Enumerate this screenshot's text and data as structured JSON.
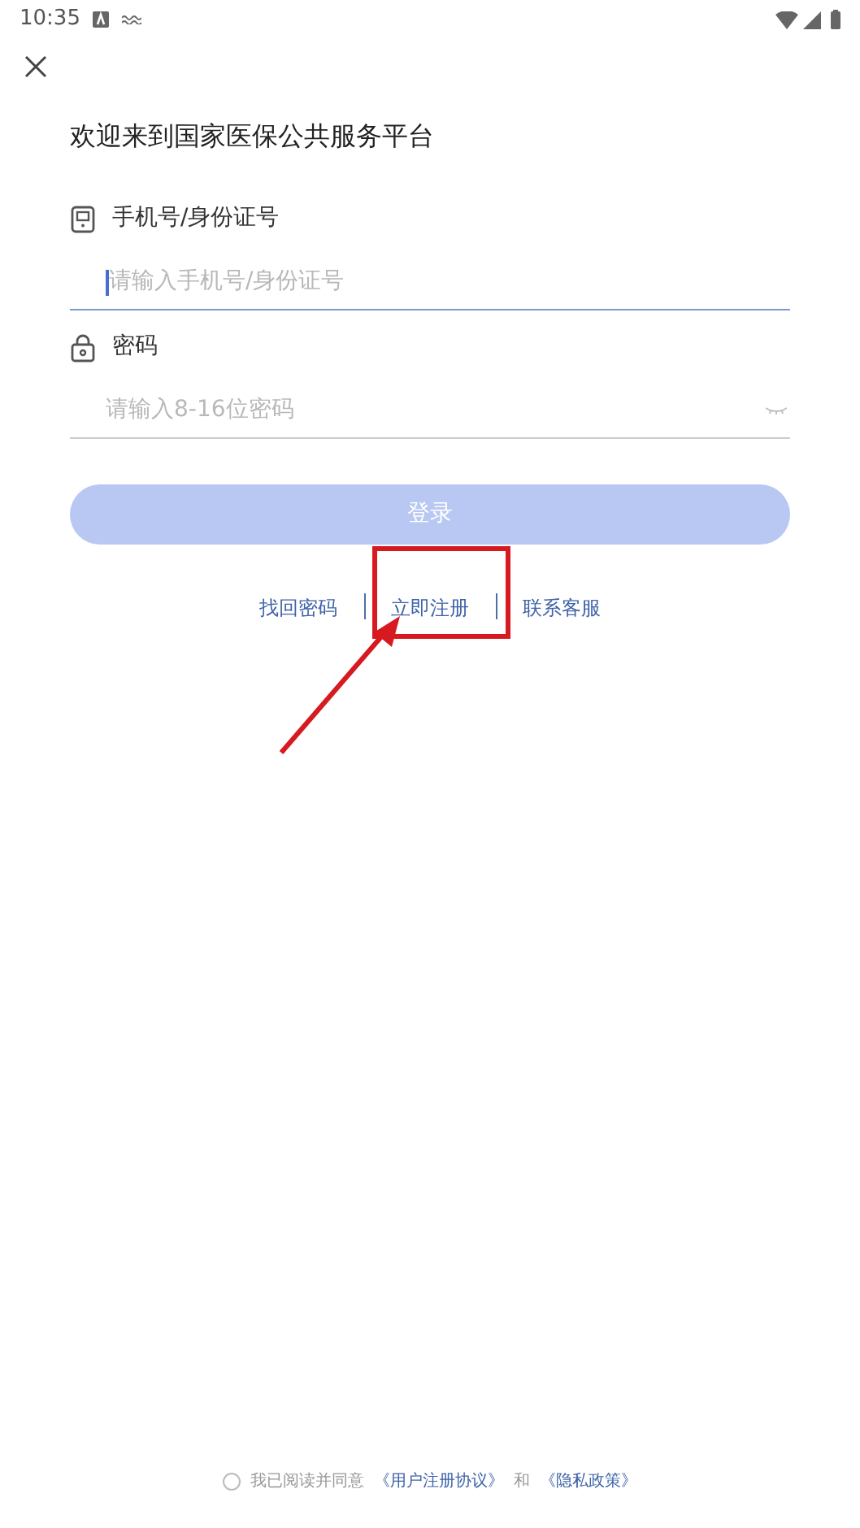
{
  "status_bar": {
    "time": "10:35"
  },
  "title": "欢迎来到国家医保公共服务平台",
  "fields": [
    {
      "kind": "phone",
      "label": "手机号/身份证号",
      "placeholder": "请输入手机号/身份证号",
      "focused": true
    },
    {
      "kind": "password",
      "label": "密码",
      "placeholder": "请输入8-16位密码",
      "focused": false
    }
  ],
  "login_button": {
    "label": "登录",
    "disabled": true
  },
  "links": [
    {
      "label": "找回密码",
      "highlighted": false
    },
    {
      "label": "立即注册",
      "highlighted": true
    },
    {
      "label": "联系客服",
      "highlighted": false
    }
  ],
  "agreement": {
    "checked": false,
    "text": "我已阅读并同意",
    "link_1": "《用户注册协议》",
    "conjunction": "和",
    "link_2": "《隐私政策》"
  }
}
